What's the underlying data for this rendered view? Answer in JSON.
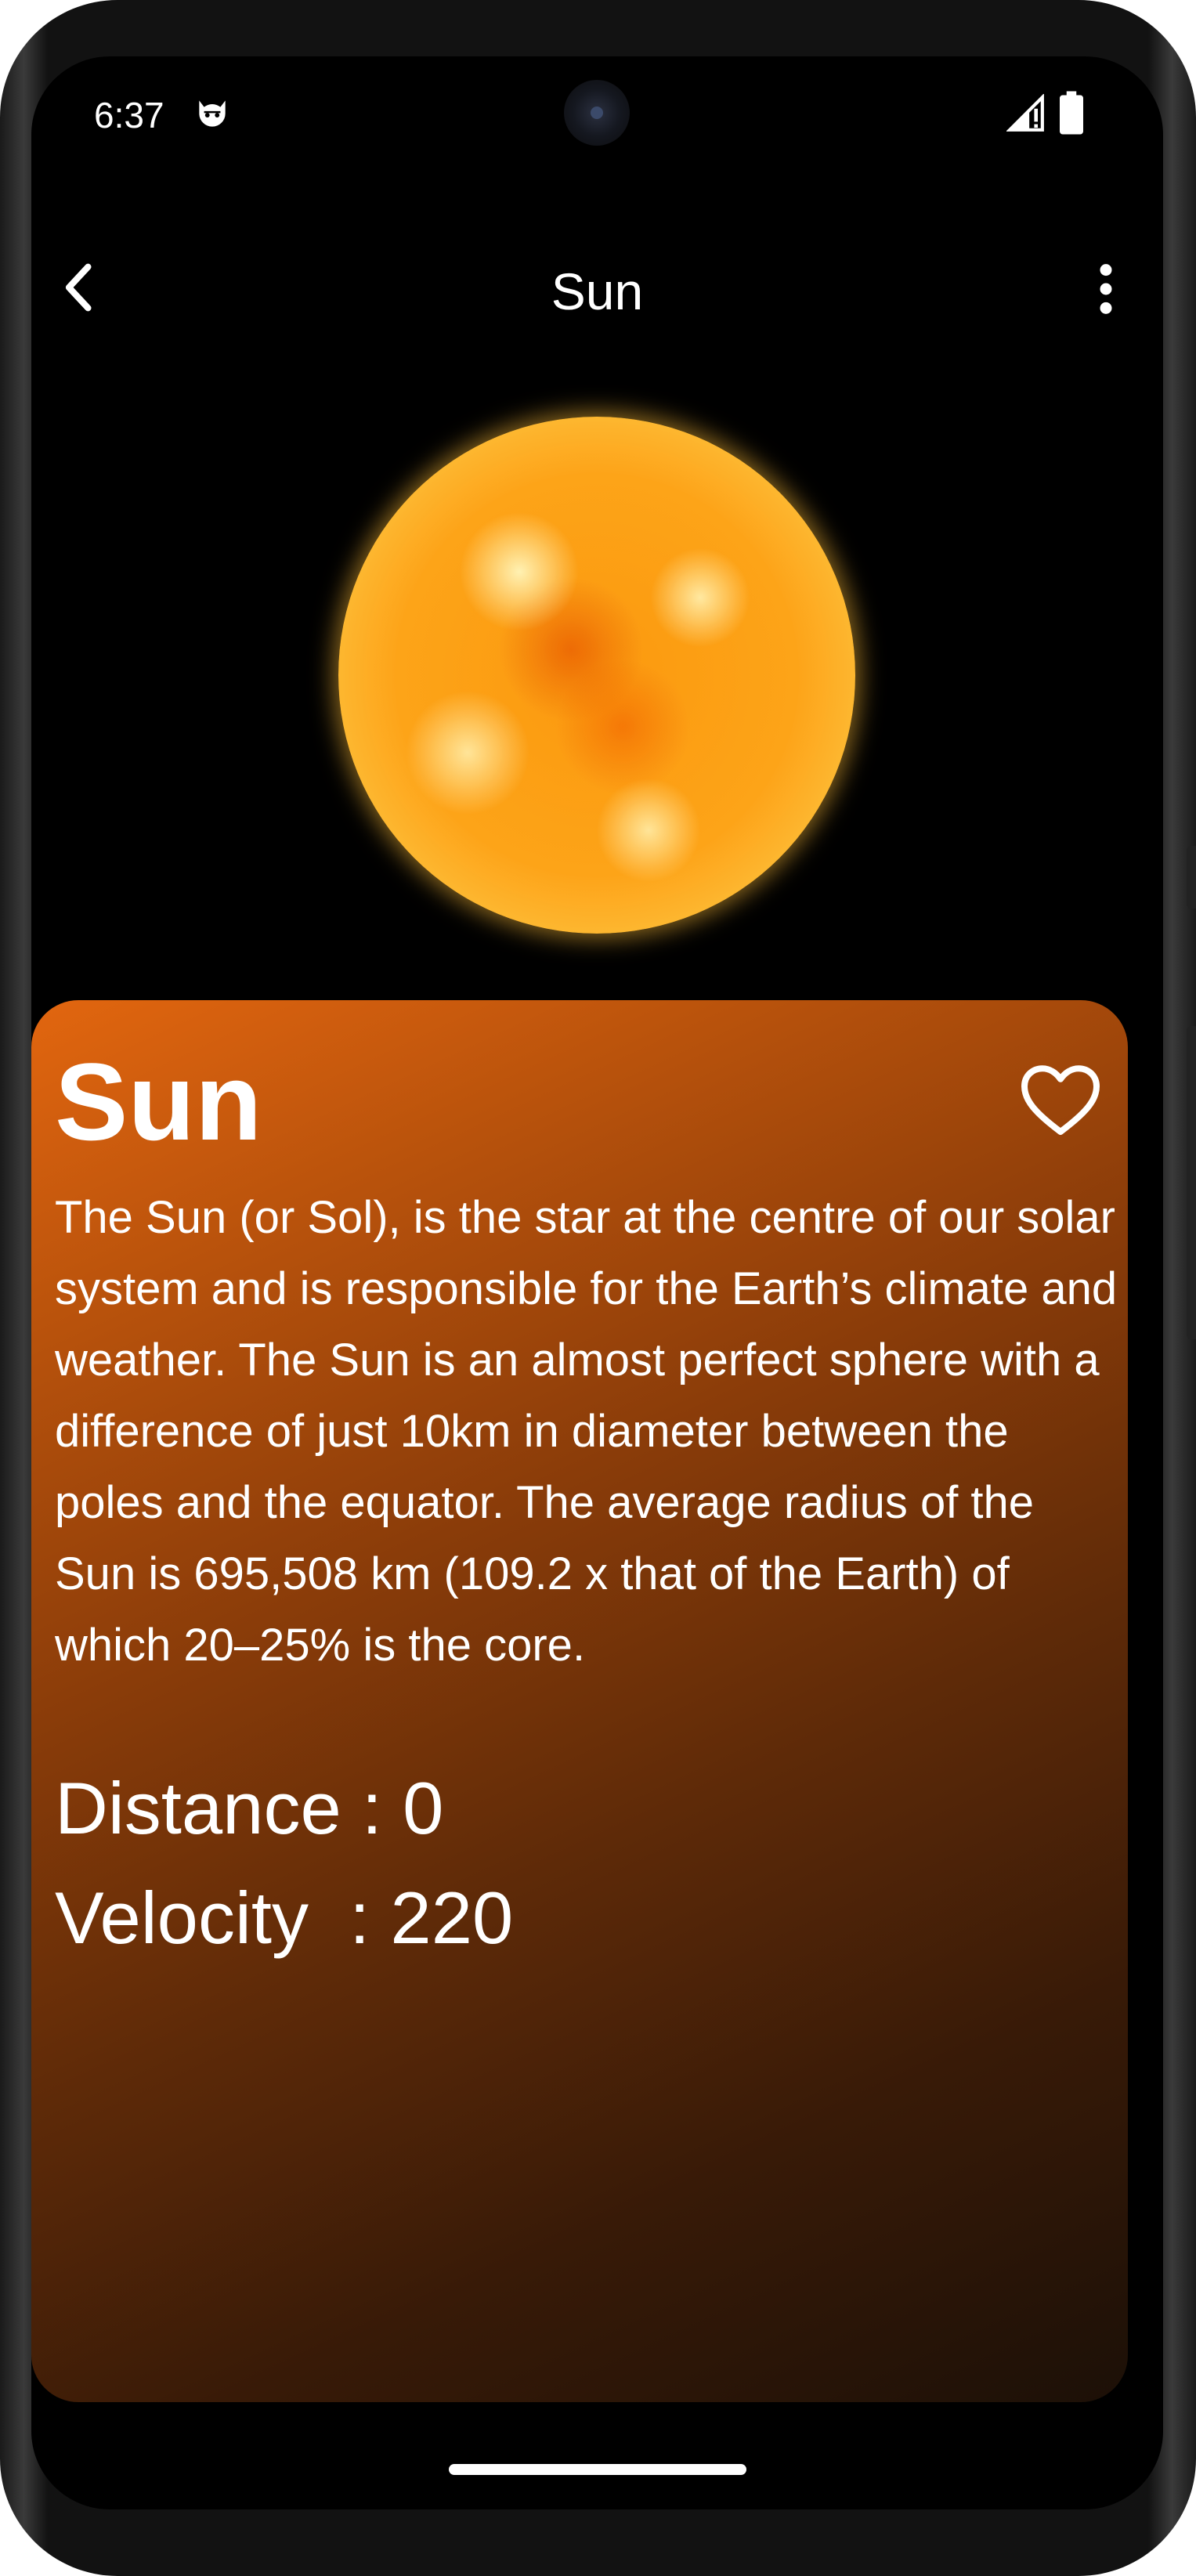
{
  "status_bar": {
    "time": "6:37",
    "icons": [
      "cat-face-icon",
      "signal-icon",
      "battery-icon"
    ]
  },
  "app_bar": {
    "title": "Sun",
    "back_icon": "chevron-left-icon",
    "menu_icon": "more-vertical-icon"
  },
  "hero": {
    "image": "sun-illustration"
  },
  "card": {
    "title": "Sun",
    "favorite_icon": "heart-outline-icon",
    "description": "The Sun (or Sol), is the star at the centre of our solar system and is responsible for the Earth’s climate and weather. The Sun is an almost perfect sphere with a difference of just 10km in diameter between the poles and the equator. The average radius of the Sun is 695,508 km (109.2 x that of the Earth) of which 20–25% is the core.",
    "distance": "Distance : 0",
    "velocity": "Velocity  : 220"
  },
  "colors": {
    "background": "#000000",
    "card_gradient_start": "#e2660f",
    "card_gradient_end": "#1c1007",
    "text": "#ffffff"
  }
}
